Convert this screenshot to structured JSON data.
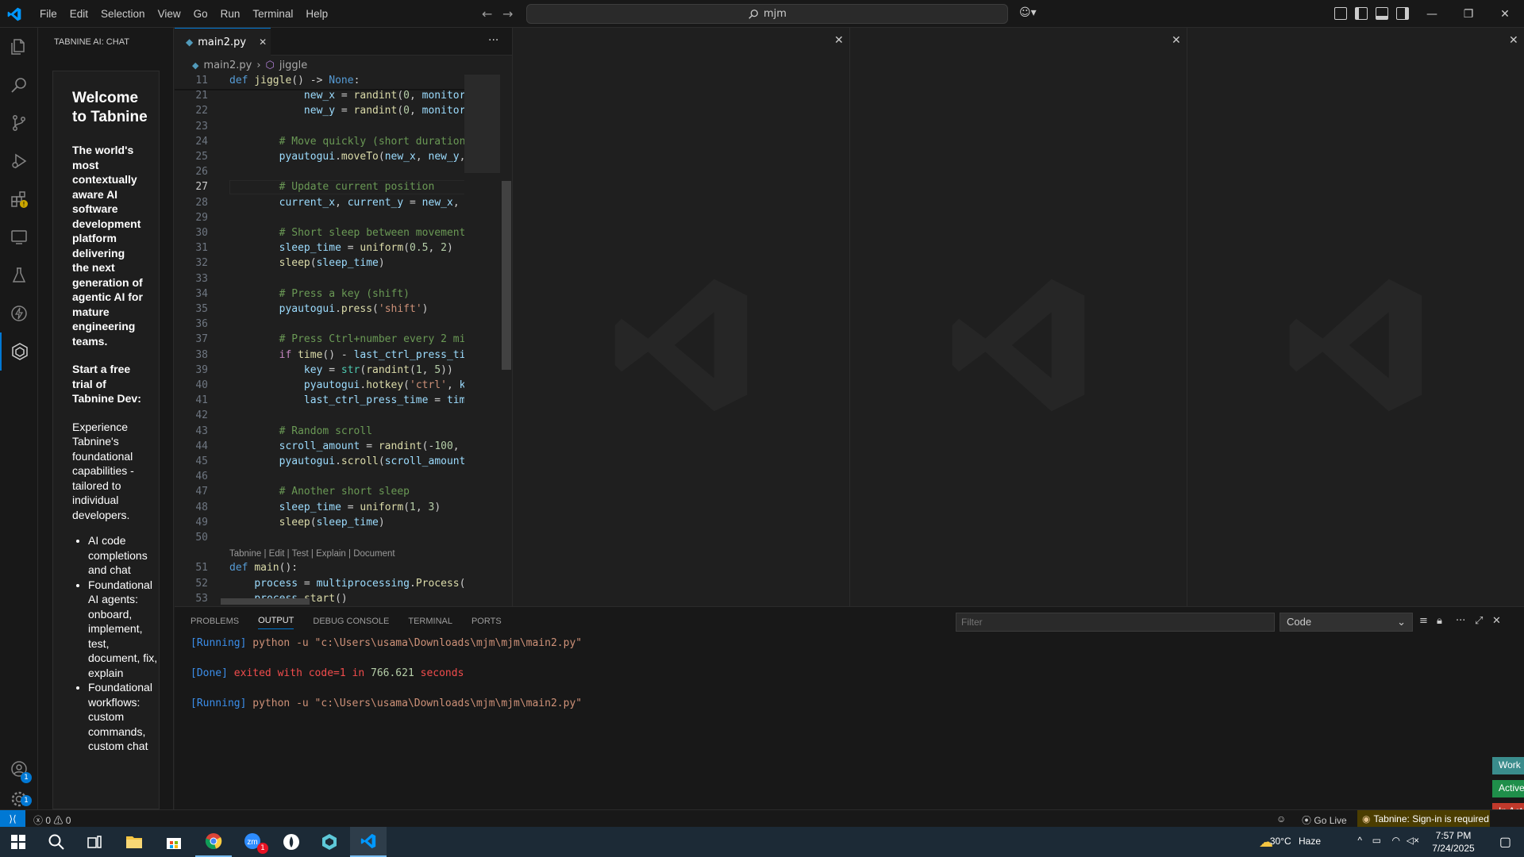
{
  "titlebar": {
    "menu": [
      "File",
      "Edit",
      "Selection",
      "View",
      "Go",
      "Run",
      "Terminal",
      "Help"
    ],
    "search_text": "mjm",
    "window_controls": [
      "minimize-icon",
      "restore-icon",
      "close-icon"
    ]
  },
  "activitybar": {
    "items": [
      "explorer-icon",
      "search-icon",
      "source-control-icon",
      "run-debug-icon",
      "extensions-icon",
      "remote-explorer-icon",
      "testing-icon",
      "thunder-icon",
      "tabnine-icon"
    ],
    "accounts_badge": "1",
    "settings_badge": "1"
  },
  "sidebar": {
    "header": "TABNINE AI: CHAT",
    "welcome_title": "Welcome to Tabnine",
    "intro": "The world's most contextually aware AI software development platform delivering the next generation of agentic AI for mature engineering teams.",
    "trial_heading": "Start a free trial of Tabnine Dev:",
    "experience": "Experience Tabnine's foundational capabilities - tailored to individual developers.",
    "bullets": [
      "AI code completions and chat",
      "Foundational AI agents: onboard, implement, test, document, fix, explain",
      "Foundational workflows: custom commands, custom chat"
    ]
  },
  "editor": {
    "tab_label": "main2.py",
    "breadcrumb": [
      "main2.py",
      "jiggle"
    ],
    "codelens": "Tabnine | Edit | Test | Explain | Document",
    "current_line": 27,
    "lines": [
      {
        "n": "11",
        "t": "def jiggle() -> None:"
      },
      {
        "n": "21",
        "t": "            new_x = randint(0, monitor"
      },
      {
        "n": "22",
        "t": "            new_y = randint(0, monitor"
      },
      {
        "n": "23",
        "t": ""
      },
      {
        "n": "24",
        "t": "        # Move quickly (short duration"
      },
      {
        "n": "25",
        "t": "        pyautogui.moveTo(new_x, new_y,"
      },
      {
        "n": "26",
        "t": ""
      },
      {
        "n": "27",
        "t": "        # Update current position"
      },
      {
        "n": "28",
        "t": "        current_x, current_y = new_x,"
      },
      {
        "n": "29",
        "t": ""
      },
      {
        "n": "30",
        "t": "        # Short sleep between movement"
      },
      {
        "n": "31",
        "t": "        sleep_time = uniform(0.5, 2)"
      },
      {
        "n": "32",
        "t": "        sleep(sleep_time)"
      },
      {
        "n": "33",
        "t": ""
      },
      {
        "n": "34",
        "t": "        # Press a key (shift)"
      },
      {
        "n": "35",
        "t": "        pyautogui.press('shift')"
      },
      {
        "n": "36",
        "t": ""
      },
      {
        "n": "37",
        "t": "        # Press Ctrl+number every 2 mi"
      },
      {
        "n": "38",
        "t": "        if time() - last_ctrl_press_ti"
      },
      {
        "n": "39",
        "t": "            key = str(randint(1, 5))"
      },
      {
        "n": "40",
        "t": "            pyautogui.hotkey('ctrl', k"
      },
      {
        "n": "41",
        "t": "            last_ctrl_press_time = tim"
      },
      {
        "n": "42",
        "t": ""
      },
      {
        "n": "43",
        "t": "        # Random scroll"
      },
      {
        "n": "44",
        "t": "        scroll_amount = randint(-100,"
      },
      {
        "n": "45",
        "t": "        pyautogui.scroll(scroll_amount"
      },
      {
        "n": "46",
        "t": ""
      },
      {
        "n": "47",
        "t": "        # Another short sleep"
      },
      {
        "n": "48",
        "t": "        sleep_time = uniform(1, 3)"
      },
      {
        "n": "49",
        "t": "        sleep(sleep_time)"
      },
      {
        "n": "50",
        "t": ""
      },
      {
        "n": "51",
        "t": "def main():"
      },
      {
        "n": "52",
        "t": "    process = multiprocessing.Process("
      },
      {
        "n": "53",
        "t": "    process.start()"
      }
    ]
  },
  "panel": {
    "tabs": [
      "PROBLEMS",
      "OUTPUT",
      "DEBUG CONSOLE",
      "TERMINAL",
      "PORTS"
    ],
    "active_tab": "OUTPUT",
    "filter_placeholder": "Filter",
    "channel": "Code",
    "output": {
      "run1_tag": "[Running]",
      "run1_cmd": "python -u \"c:\\Users\\usama\\Downloads\\mjm\\mjm\\main2.py\"",
      "done_tag": "[Done]",
      "done_text1": "exited with",
      "done_code": "code=1",
      "done_text2": "in",
      "done_seconds": "766.621",
      "done_text3": "seconds",
      "run2_tag": "[Running]",
      "run2_cmd": "python -u \"c:\\Users\\usama\\Downloads\\mjm\\mjm\\main2.py\""
    },
    "side_pills": [
      {
        "label": "Work",
        "color": "#3a8c8c"
      },
      {
        "label": "Active",
        "color": "#1f8f4a"
      },
      {
        "label": "In Act",
        "color": "#c0392b"
      }
    ]
  },
  "statusbar": {
    "errors": "0",
    "warnings": "0",
    "go_live": "Go Live",
    "tabnine": "Tabnine: Sign-in is required"
  },
  "taskbar": {
    "apps": [
      "windows-start-icon",
      "search-icon",
      "task-view-icon",
      "file-explorer-icon",
      "store-icon",
      "chrome-icon",
      "zoom-icon",
      "app-icon",
      "tabnine-app-icon",
      "vscode-icon"
    ],
    "zoom_badge": "1",
    "weather_temp": "30°C",
    "weather_desc": "Haze",
    "time": "7:57 PM",
    "date": "7/24/2025"
  },
  "colors": {
    "accent": "#0078d4",
    "editor_bg": "#1f1f1f",
    "chrome_bg": "#181818"
  }
}
